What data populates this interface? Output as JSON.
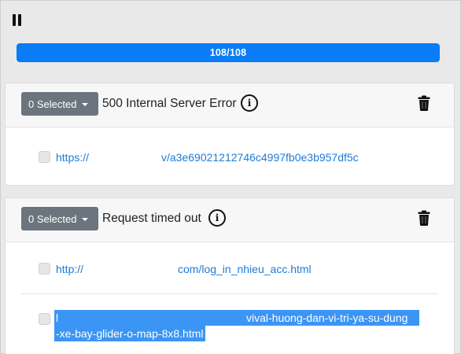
{
  "progress": {
    "label": "108/108",
    "fraction": 1.0
  },
  "groups": [
    {
      "selected_label": "0 Selected",
      "error": "500 Internal Server Error",
      "rows": [
        {
          "url_start": "https://",
          "url_end": "v/a3e69021212746c4997fb0e3b957df5c"
        }
      ]
    },
    {
      "selected_label": "0 Selected",
      "error": "Request timed out",
      "rows": [
        {
          "url_start": "http://",
          "url_end": "com/log_in_nhieu_acc.html"
        },
        {
          "url_start": "l",
          "url_end": "vival-huong-dan-vi-tri-ya-su-dung",
          "url_line2": "-xe-bay-glider-o-map-8x8.html"
        }
      ]
    }
  ],
  "icons": {
    "pause": "pause-icon",
    "info": "info-circle-icon",
    "trash": "trash-icon",
    "caret": "caret-down-icon"
  },
  "colors": {
    "progress": "#0a7cf5",
    "link": "#1f7ad6",
    "highlight": "#3b95f5",
    "selected_button": "#6c757d"
  }
}
